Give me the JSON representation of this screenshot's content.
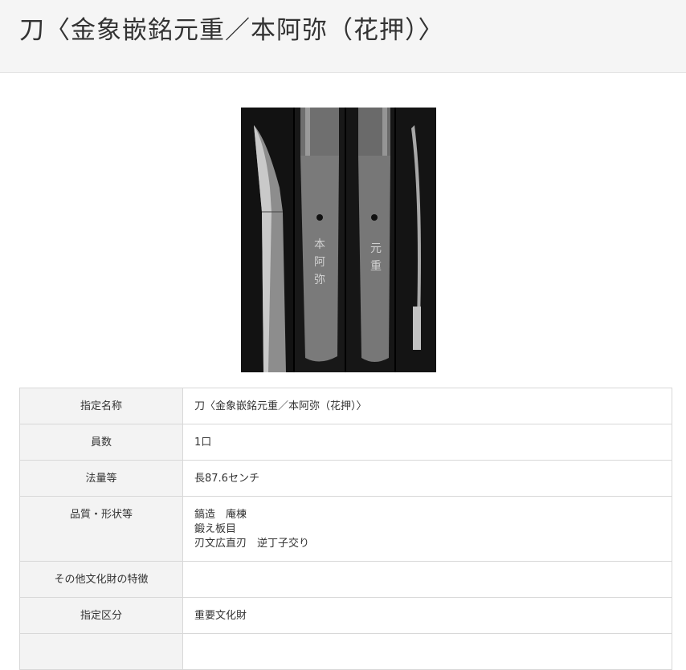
{
  "page": {
    "title": "刀〈金象嵌銘元重／本阿弥（花押）〉"
  },
  "image": {
    "description_icon": "sword-photo"
  },
  "details": {
    "rows": [
      {
        "label": "指定名称",
        "lines": [
          "刀〈金象嵌銘元重／本阿弥（花押）〉"
        ]
      },
      {
        "label": "員数",
        "lines": [
          "1口"
        ]
      },
      {
        "label": "法量等",
        "lines": [
          "長87.6センチ"
        ]
      },
      {
        "label": "品質・形状等",
        "lines": [
          "鎬造　庵棟",
          "鍛え板目",
          "刃文広直刃　逆丁子交り"
        ]
      },
      {
        "label": "その他文化財の特徴",
        "lines": []
      },
      {
        "label": "指定区分",
        "lines": [
          "重要文化財"
        ]
      },
      {
        "label": "",
        "lines": []
      }
    ]
  }
}
